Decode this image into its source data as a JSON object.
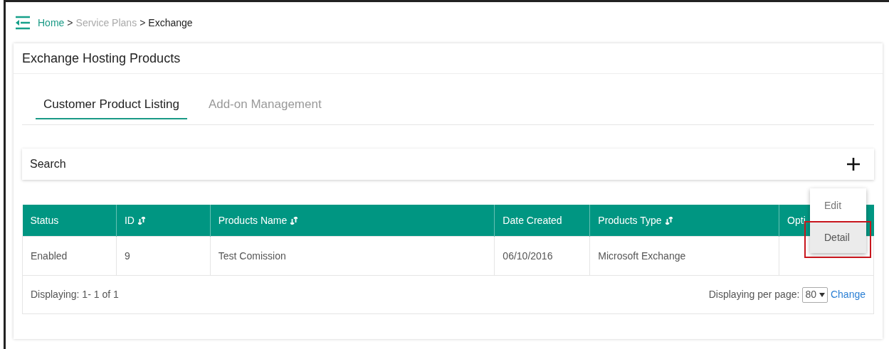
{
  "breadcrumb": [
    {
      "label": "Home",
      "kind": "link"
    },
    {
      "label": "Service Plans",
      "kind": "muted"
    },
    {
      "label": "Exchange",
      "kind": "current"
    }
  ],
  "breadcrumb_separator": ">",
  "panel": {
    "title": "Exchange Hosting Products"
  },
  "tabs": [
    {
      "label": "Customer Product Listing",
      "selected": true
    },
    {
      "label": "Add-on Management",
      "selected": false
    }
  ],
  "search": {
    "label": "Search"
  },
  "table": {
    "columns": [
      {
        "label": "Status",
        "sortable": false
      },
      {
        "label": "ID",
        "sortable": true
      },
      {
        "label": "Products Name",
        "sortable": true
      },
      {
        "label": "Date Created",
        "sortable": false
      },
      {
        "label": "Products Type",
        "sortable": true
      },
      {
        "label": "Opti",
        "kind": "partly-hidden"
      }
    ],
    "rows": [
      [
        "Enabled",
        "9",
        "Test Comission",
        "06/10/2016",
        "Microsoft Exchange"
      ]
    ]
  },
  "footer": {
    "displaying": "Displaying: 1- 1 of 1",
    "per_page_label": "Displaying per page:",
    "per_page_value": "80",
    "change_link": "Change"
  },
  "menu": {
    "items": [
      {
        "label": "Edit",
        "selected": false
      },
      {
        "label": "Detail",
        "selected": true
      }
    ]
  }
}
